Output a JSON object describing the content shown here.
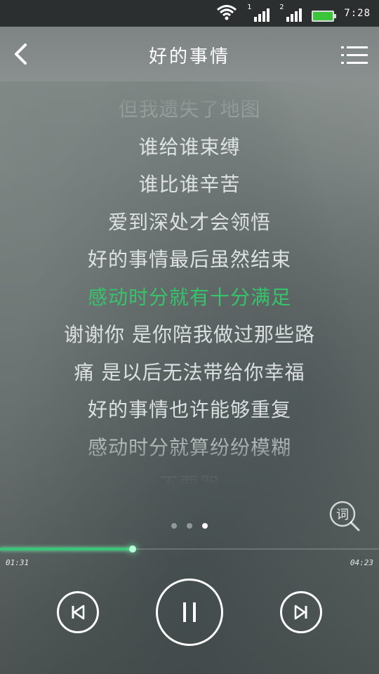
{
  "status_bar": {
    "time": "7:28",
    "signal1_tag": "1",
    "signal2_tag": "2"
  },
  "header": {
    "title": "好的事情"
  },
  "lyrics": [
    {
      "text": "但我遗失了地图",
      "state": "dim"
    },
    {
      "text": "谁给谁束缚",
      "state": "normal"
    },
    {
      "text": "谁比谁辛苦",
      "state": "normal"
    },
    {
      "text": "爱到深处才会领悟",
      "state": "normal"
    },
    {
      "text": "好的事情最后虽然结束",
      "state": "normal"
    },
    {
      "text": "感动时分就有十分满足",
      "state": "active"
    },
    {
      "text": "谢谢你 是你陪我做过那些路",
      "state": "normal"
    },
    {
      "text": "痛 是以后无法带给你幸福",
      "state": "normal"
    },
    {
      "text": "好的事情也许能够重复",
      "state": "normal"
    },
    {
      "text": "感动时分就算纷纷模糊",
      "state": "normal"
    },
    {
      "text": "不要哭",
      "state": "dim"
    }
  ],
  "lyric_search": {
    "label": "词"
  },
  "pager": {
    "count": 3,
    "active_index": 2
  },
  "player": {
    "current_time": "01:31",
    "total_time": "04:23",
    "progress": 0.35
  },
  "colors": {
    "accent": "#35c46a",
    "battery": "#3cc53c",
    "statusbar": "#2b2f30"
  },
  "icons": {
    "back": "back-arrow-icon",
    "menu": "playlist-menu-icon",
    "prev": "skip-previous-icon",
    "pause": "pause-icon",
    "next": "skip-next-icon"
  }
}
